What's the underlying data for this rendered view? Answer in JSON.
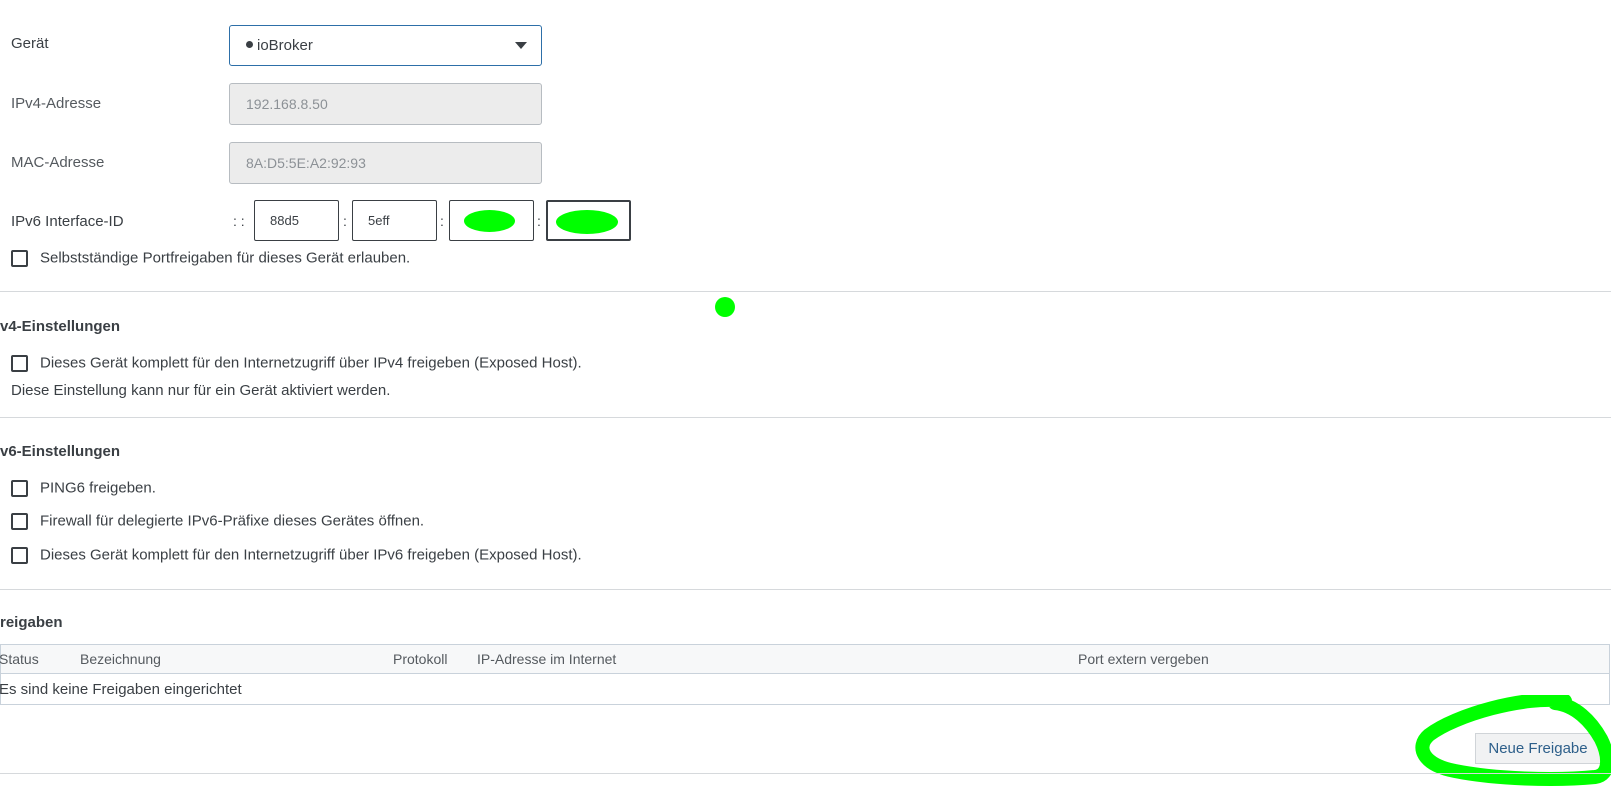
{
  "device": {
    "label": "Gerät",
    "selected": "ioBroker"
  },
  "ipv4": {
    "label": "IPv4-Adresse",
    "value": "192.168.8.50"
  },
  "mac": {
    "label": "MAC-Adresse",
    "value": "8A:D5:5E:A2:92:93"
  },
  "ipv6_interface": {
    "label": "IPv6 Interface-ID",
    "prefix": ": :",
    "separator": ":",
    "segments": [
      "88d5",
      "5eff",
      "",
      ""
    ]
  },
  "allow_portfw": {
    "label": "Selbstständige Portfreigaben für dieses Gerät erlauben.",
    "checked": false
  },
  "ipv4_settings": {
    "title": "v4-Einstellungen",
    "exposed_host": {
      "label": "Dieses Gerät komplett für den Internetzugriff über IPv4 freigeben (Exposed Host).",
      "checked": false
    },
    "note": "Diese Einstellung kann nur für ein Gerät aktiviert werden."
  },
  "ipv6_settings": {
    "title": "v6-Einstellungen",
    "ping6": {
      "label": "PING6 freigeben.",
      "checked": false
    },
    "firewall": {
      "label": "Firewall für delegierte IPv6-Präfixe dieses Gerätes öffnen.",
      "checked": false
    },
    "exposed_host": {
      "label": "Dieses Gerät komplett für den Internetzugriff über IPv6 freigeben (Exposed Host).",
      "checked": false
    }
  },
  "shares": {
    "title": "reigaben",
    "columns": [
      "Status",
      "Bezeichnung",
      "Protokoll",
      "IP-Adresse im Internet",
      "Port extern vergeben"
    ],
    "empty": "Es sind keine Freigaben eingerichtet",
    "new_button": "Neue Freigabe"
  },
  "colors": {
    "accent": "#2d6fa8",
    "highlight": "#00ff00",
    "text": "#3a3f44",
    "disabled_bg": "#ececec"
  }
}
